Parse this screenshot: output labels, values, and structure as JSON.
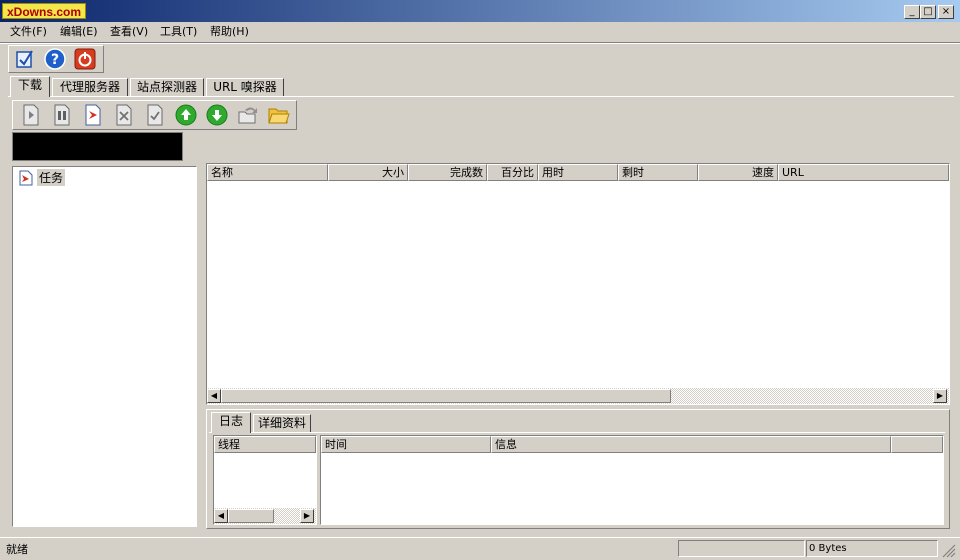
{
  "window": {
    "logo_text": "xDowns.com",
    "minimize_glyph": "_",
    "maximize_glyph": "□",
    "close_glyph": "×"
  },
  "menu": [
    "文件(F)",
    "编辑(E)",
    "查看(V)",
    "工具(T)",
    "帮助(H)"
  ],
  "main_toolbar": {
    "icons": [
      "edit-options-icon",
      "help-icon",
      "power-icon"
    ],
    "colors": {
      "help": "#1f5fc9",
      "power": "#d63c1f"
    }
  },
  "tabs": [
    "下载",
    "代理服务器",
    "站点探测器",
    "URL 嗅探器"
  ],
  "download_toolbar": {
    "icons": [
      "start-icon",
      "pause-icon",
      "new-task-icon",
      "delete-icon",
      "complete-icon",
      "move-up-icon",
      "move-down-icon",
      "open-file-icon",
      "open-folder-icon"
    ],
    "colors": {
      "up_down": "#2faa2f",
      "folder": "#f0c040",
      "new_task": "#d03020"
    }
  },
  "tree": {
    "root_label": "任务"
  },
  "task_list": {
    "columns": [
      "名称",
      "大小",
      "完成数",
      "百分比",
      "用时",
      "剩时",
      "速度",
      "URL"
    ]
  },
  "log_panel": {
    "tabs": [
      "日志",
      "详细资料"
    ],
    "thread_header": "线程",
    "columns": [
      "时间",
      "信息"
    ]
  },
  "statusbar": {
    "status": "就绪",
    "bytes": "0 Bytes"
  }
}
